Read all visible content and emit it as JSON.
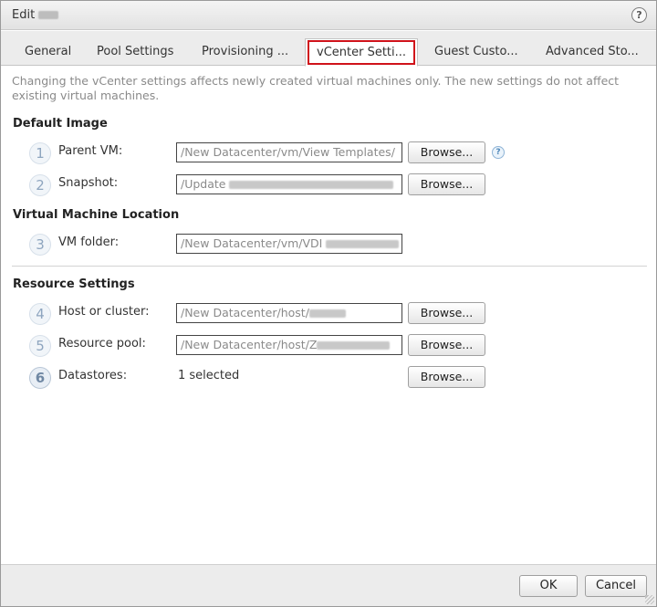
{
  "window": {
    "title": "Edit",
    "help_glyph": "?"
  },
  "tabs": [
    {
      "label": "General"
    },
    {
      "label": "Pool Settings"
    },
    {
      "label": "Provisioning ..."
    },
    {
      "label": "vCenter Setti..."
    },
    {
      "label": "Guest Custo..."
    },
    {
      "label": "Advanced Sto..."
    }
  ],
  "active_tab": "vCenter Setti...",
  "description": "Changing the vCenter settings affects newly created virtual machines only. The new settings do not affect existing virtual machines.",
  "sections": {
    "default_image": "Default Image",
    "vm_location": "Virtual Machine Location",
    "resource_settings": "Resource Settings"
  },
  "rows": [
    {
      "step": "1",
      "label": "Parent VM:",
      "value": "/New Datacenter/vm/View Templates/",
      "button": "Browse..."
    },
    {
      "step": "2",
      "label": "Snapshot:",
      "value": "/Update",
      "button": "Browse..."
    },
    {
      "step": "3",
      "label": "VM folder:",
      "value": "/New Datacenter/vm/VDI"
    },
    {
      "step": "4",
      "label": "Host or cluster:",
      "value": "/New Datacenter/host/",
      "button": "Browse..."
    },
    {
      "step": "5",
      "label": "Resource pool:",
      "value": "/New Datacenter/host/Z",
      "button": "Browse..."
    },
    {
      "step": "6",
      "label": "Datastores:",
      "value": "1 selected",
      "button": "Browse..."
    }
  ],
  "field_help_glyph": "?",
  "footer": {
    "ok": "OK",
    "cancel": "Cancel"
  },
  "colors": {
    "active_tab_highlight": "#d0121a",
    "step_circle": "#8ea5bf"
  }
}
